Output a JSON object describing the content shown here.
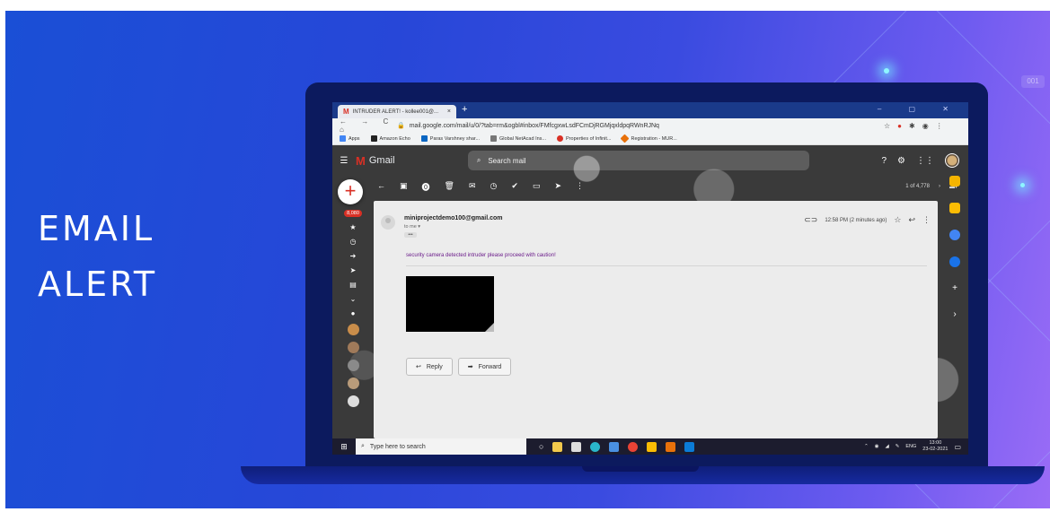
{
  "slide": {
    "headline_line1": "EMAIL",
    "headline_line2": "ALERT",
    "corner_label": "001"
  },
  "browser": {
    "tab_title": "INTRUDER ALERT! - kollee001@...",
    "tab_close": "×",
    "new_tab": "+",
    "window_controls": "– ▢ ✕",
    "nav_buttons": "← → C ⌂",
    "url": "mail.google.com/mail/u/0/?tab=rm&ogbl#inbox/FMfcgxwLsdFCmDjRGMjqxldpqRWnRJNq",
    "bookmarks": [
      {
        "label": "Apps",
        "color": "#4285f4"
      },
      {
        "label": "Amazon Echo",
        "color": "#222222"
      },
      {
        "label": "Paras Varshney shar...",
        "color": "#0a66c2"
      },
      {
        "label": "Global NetAcad Ins...",
        "color": "#777777"
      },
      {
        "label": "Properties of Infinit...",
        "color": "#d93025"
      },
      {
        "label": "Registration - MUR...",
        "color": "#e8710a"
      }
    ]
  },
  "gmail": {
    "logo_icon": "gmail-m-icon",
    "app_name": "Gmail",
    "search_placeholder": "Search mail",
    "pager": "1 of 4,778",
    "inbox_badge": "8,080",
    "compose": "+"
  },
  "message": {
    "sender": "miniprojectdemo100@gmail.com",
    "to": "to me ▾",
    "expand": "•••",
    "time": "12:58 PM (2 minutes ago)",
    "body": "security camera detected intruder please proceed with caution!",
    "reply_label": "Reply",
    "forward_label": "Forward"
  },
  "taskbar": {
    "search_placeholder": "Type here to search",
    "lang": "ENG",
    "time": "13:00",
    "date": "23-02-2021"
  },
  "colors": {
    "gmail_red": "#d93025",
    "body_text": "#6a1b8a",
    "slide_blue": "#2747d8"
  }
}
